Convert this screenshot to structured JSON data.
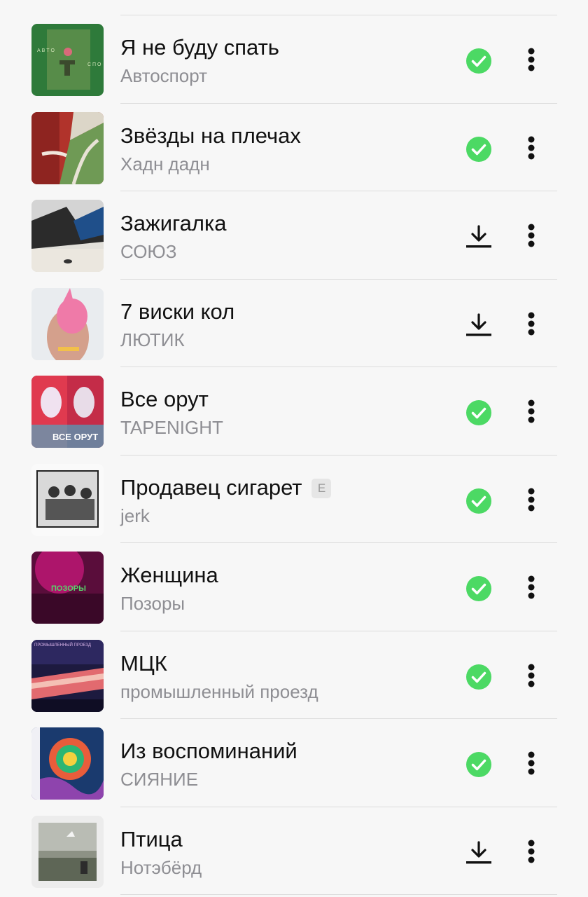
{
  "tracks": [
    {
      "title": "Я не буду спать",
      "artist": "Автоспорт",
      "status": "downloaded",
      "explicit": false,
      "cover_icon": "album-cover-green"
    },
    {
      "title": "Звёзды на плечах",
      "artist": "Хадн дадн",
      "status": "downloaded",
      "explicit": false,
      "cover_icon": "album-cover-red-curtain"
    },
    {
      "title": "Зажигалка",
      "artist": "СОЮЗ",
      "status": "download",
      "explicit": false,
      "cover_icon": "album-cover-city"
    },
    {
      "title": "7 виски кол",
      "artist": "ЛЮТИК",
      "status": "download",
      "explicit": false,
      "cover_icon": "album-cover-pink-hair"
    },
    {
      "title": "Все орут",
      "artist": "TAPENIGHT",
      "status": "downloaded",
      "explicit": false,
      "cover_icon": "album-cover-screaming"
    },
    {
      "title": "Продавец сигарет",
      "artist": "jerk",
      "status": "downloaded",
      "explicit": true,
      "explicit_label": "E",
      "cover_icon": "album-cover-bw-photo"
    },
    {
      "title": "Женщина",
      "artist": "Позоры",
      "status": "downloaded",
      "explicit": false,
      "cover_icon": "album-cover-magenta"
    },
    {
      "title": "МЦК",
      "artist": "промышленный проезд",
      "status": "downloaded",
      "explicit": false,
      "cover_icon": "album-cover-train"
    },
    {
      "title": "Из воспоминаний",
      "artist": "СИЯНИЕ",
      "status": "downloaded",
      "explicit": false,
      "cover_icon": "album-cover-psychedelic"
    },
    {
      "title": "Птица",
      "artist": "Нотэбёрд",
      "status": "download",
      "explicit": false,
      "cover_icon": "album-cover-grey-field"
    }
  ],
  "colors": {
    "downloaded_check": "#4cd964",
    "icon_dark": "#111111",
    "secondary_text": "#8e8e93"
  }
}
